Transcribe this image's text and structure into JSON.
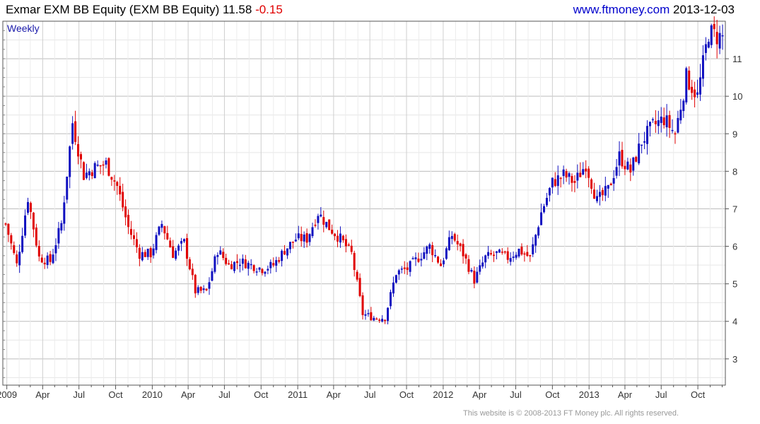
{
  "header": {
    "title": "Exmar EXM BB Equity (EXM BB Equity)",
    "last": "11.58",
    "change": "-0.15",
    "site": "www.ftmoney.com",
    "date": "2013-12-03"
  },
  "footer": "This website is © 2008-2013 FT Money plc. All rights reserved.",
  "colors": {
    "up": "#1010c0",
    "down": "#e00000",
    "grid": "#cccccc"
  },
  "chart_data": {
    "type": "candlestick",
    "title": "Exmar EXM BB Equity (EXM BB Equity)",
    "period_label": "Weekly",
    "x_ticks": [
      "2009",
      "Apr",
      "Jul",
      "Oct",
      "2010",
      "Apr",
      "Jul",
      "Oct",
      "2011",
      "Apr",
      "Jul",
      "Oct",
      "2012",
      "Apr",
      "Jul",
      "Oct",
      "2013",
      "Apr",
      "Jul",
      "Oct"
    ],
    "y_ticks": [
      3,
      4,
      5,
      6,
      7,
      8,
      9,
      10,
      11
    ],
    "ylim": [
      2.3,
      12.0
    ],
    "xlim": [
      "2008-12-22",
      "2013-12-09"
    ],
    "y_axis_side": "right",
    "grid": true,
    "series": [
      {
        "name": "Weekly close",
        "x": [
          "2008-12-29",
          "2009-01-26",
          "2009-02-23",
          "2009-03-23",
          "2009-04-20",
          "2009-05-18",
          "2009-06-15",
          "2009-07-13",
          "2009-08-10",
          "2009-09-07",
          "2009-10-05",
          "2009-11-02",
          "2009-11-30",
          "2009-12-28",
          "2010-01-25",
          "2010-02-22",
          "2010-03-22",
          "2010-04-19",
          "2010-05-17",
          "2010-06-14",
          "2010-07-12",
          "2010-08-09",
          "2010-09-06",
          "2010-10-04",
          "2010-11-01",
          "2010-11-29",
          "2010-12-27",
          "2011-01-24",
          "2011-02-21",
          "2011-03-21",
          "2011-04-18",
          "2011-05-16",
          "2011-06-13",
          "2011-07-11",
          "2011-08-08",
          "2011-09-05",
          "2011-10-03",
          "2011-10-31",
          "2011-11-28",
          "2011-12-26",
          "2012-01-23",
          "2012-02-20",
          "2012-03-19",
          "2012-04-16",
          "2012-05-14",
          "2012-06-11",
          "2012-07-09",
          "2012-08-06",
          "2012-09-03",
          "2012-10-01",
          "2012-10-29",
          "2012-11-26",
          "2012-12-24",
          "2013-01-21",
          "2013-02-18",
          "2013-03-18",
          "2013-04-15",
          "2013-05-13",
          "2013-06-10",
          "2013-07-08",
          "2013-08-05",
          "2013-09-02",
          "2013-09-30",
          "2013-10-28",
          "2013-11-18",
          "2013-12-02"
        ],
        "close": [
          6.6,
          5.5,
          7.3,
          5.7,
          5.6,
          6.6,
          9.3,
          7.9,
          8.1,
          8.2,
          7.6,
          6.5,
          5.8,
          5.8,
          6.6,
          5.8,
          6.1,
          4.8,
          4.8,
          5.9,
          5.5,
          5.6,
          5.5,
          5.4,
          5.5,
          5.9,
          6.2,
          6.2,
          6.9,
          6.5,
          6.2,
          5.8,
          4.2,
          4.1,
          4.1,
          5.3,
          5.4,
          5.7,
          6.0,
          5.5,
          6.3,
          5.8,
          5.1,
          5.7,
          5.8,
          5.7,
          5.9,
          5.7,
          6.9,
          7.7,
          7.9,
          7.7,
          8.2,
          7.2,
          7.5,
          8.4,
          8.0,
          8.8,
          9.2,
          9.4,
          9.0,
          10.5,
          10.0,
          11.7,
          11.6,
          11.58
        ]
      }
    ]
  }
}
